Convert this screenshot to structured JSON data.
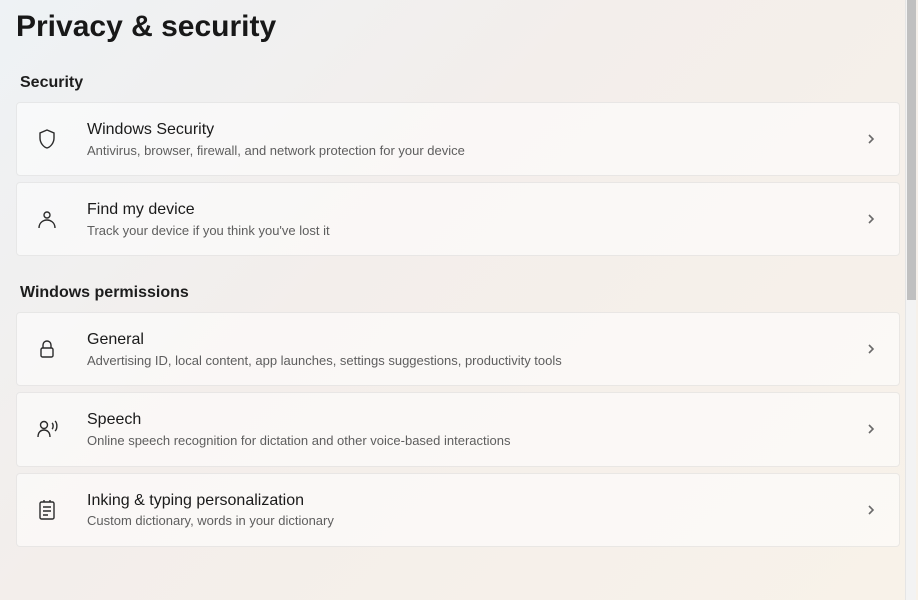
{
  "page_title": "Privacy & security",
  "sections": [
    {
      "header": "Security",
      "items": [
        {
          "icon": "shield",
          "title": "Windows Security",
          "desc": "Antivirus, browser, firewall, and network protection for your device"
        },
        {
          "icon": "find-device",
          "title": "Find my device",
          "desc": "Track your device if you think you've lost it"
        }
      ]
    },
    {
      "header": "Windows permissions",
      "items": [
        {
          "icon": "lock",
          "title": "General",
          "desc": "Advertising ID, local content, app launches, settings suggestions, productivity tools"
        },
        {
          "icon": "speech",
          "title": "Speech",
          "desc": "Online speech recognition for dictation and other voice-based interactions"
        },
        {
          "icon": "inking",
          "title": "Inking & typing personalization",
          "desc": "Custom dictionary, words in your dictionary"
        }
      ]
    }
  ]
}
